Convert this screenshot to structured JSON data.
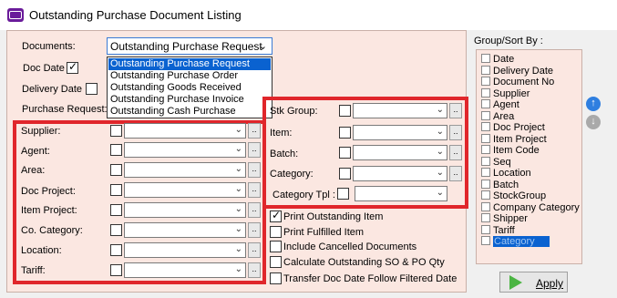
{
  "window": {
    "title": "Outstanding Purchase Document Listing"
  },
  "documents": {
    "label": "Documents:",
    "selected": "Outstanding Purchase Request",
    "options": [
      "Outstanding Purchase Request",
      "Outstanding Purchase Order",
      "Outstanding Goods Received",
      "Outstanding Purchase Invoice",
      "Outstanding Cash Purchase"
    ]
  },
  "doc_date": {
    "label": "Doc Date",
    "checked": true
  },
  "delivery_date": {
    "label": "Delivery Date",
    "checked": false
  },
  "purchase_request_label": "Purchase Request:",
  "left_filters": [
    "Supplier:",
    "Agent:",
    "Area:",
    "Doc Project:",
    "Item Project:",
    "Co. Category:",
    "Location:",
    "Tariff:"
  ],
  "right_filters": [
    "Stk Group:",
    "Item:",
    "Batch:",
    "Category:"
  ],
  "category_tpl_label": "Category Tpl :",
  "options": [
    {
      "label": "Print Outstanding Item",
      "checked": true
    },
    {
      "label": "Print Fulfilled Item",
      "checked": false
    },
    {
      "label": "Include Cancelled Documents",
      "checked": false
    },
    {
      "label": "Calculate Outstanding SO & PO Qty",
      "checked": false
    },
    {
      "label": "Transfer Doc Date Follow Filtered Date",
      "checked": false
    }
  ],
  "group_sort": {
    "title": "Group/Sort By :",
    "items": [
      "Date",
      "Delivery Date",
      "Document No",
      "Supplier",
      "Agent",
      "Area",
      "Doc Project",
      "Item Project",
      "Item Code",
      "Seq",
      "Location",
      "Batch",
      "StockGroup",
      "Company Category",
      "Shipper",
      "Tariff",
      "Category"
    ],
    "highlighted": "Category"
  },
  "apply_label": "Apply",
  "colors": {
    "highlight_border": "#e0262b",
    "selection": "#0a62d0",
    "panel_bg": "#fbe7e1"
  }
}
